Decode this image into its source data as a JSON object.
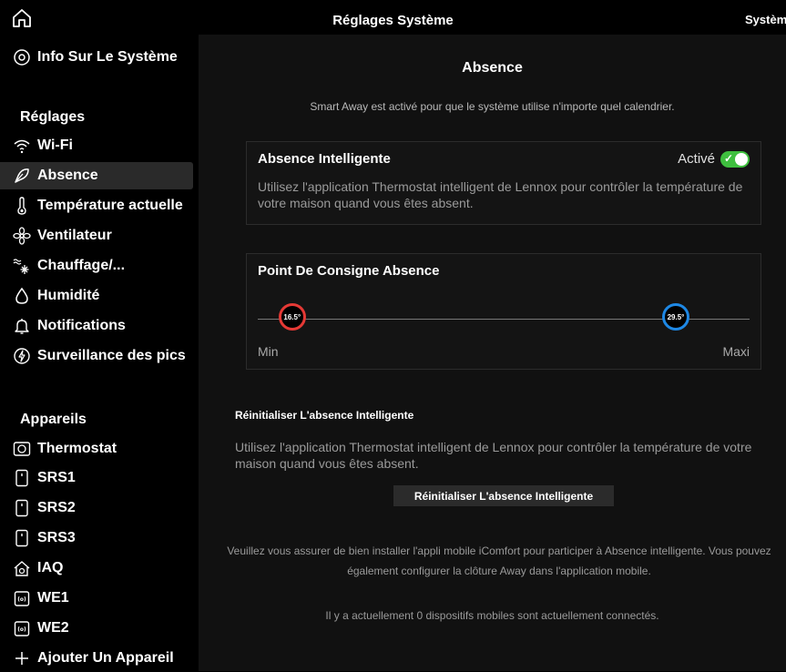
{
  "topbar": {
    "title": "Réglages Système",
    "right_label": "Système"
  },
  "sidebar": {
    "info_label": "Info Sur Le Système",
    "settings_header": "Réglages",
    "settings_items": [
      {
        "label": "Wi-Fi",
        "icon": "wifi-icon"
      },
      {
        "label": "Absence",
        "icon": "away-icon"
      },
      {
        "label": "Température actuelle",
        "icon": "thermometer-icon"
      },
      {
        "label": "Ventilateur",
        "icon": "fan-icon"
      },
      {
        "label": "Chauffage/...",
        "icon": "heat-cool-icon"
      },
      {
        "label": "Humidité",
        "icon": "humidity-icon"
      },
      {
        "label": "Notifications",
        "icon": "bell-icon"
      },
      {
        "label": "Surveillance des pics",
        "icon": "power-icon"
      }
    ],
    "devices_header": "Appareils",
    "devices": [
      {
        "label": "Thermostat",
        "icon": "thermostat-icon"
      },
      {
        "label": "SRS1",
        "icon": "sensor-icon"
      },
      {
        "label": "SRS2",
        "icon": "sensor-icon"
      },
      {
        "label": "SRS3",
        "icon": "sensor-icon"
      },
      {
        "label": "IAQ",
        "icon": "iaq-icon"
      },
      {
        "label": "WE1",
        "icon": "wifi-extender-icon"
      },
      {
        "label": "WE2",
        "icon": "wifi-extender-icon"
      }
    ],
    "add_device_label": "Ajouter Un Appareil",
    "active_item": "Absence"
  },
  "main": {
    "title": "Absence",
    "intro": "Smart Away est activé pour que le système utilise n'importe quel calendrier.",
    "smart_away_card": {
      "title": "Absence Intelligente",
      "status": "Activé",
      "enabled": true,
      "description": "Utilisez l'application Thermostat intelligent de Lennox pour contrôler la température de votre maison quand vous êtes absent."
    },
    "setpoint_card": {
      "title": "Point De Consigne Absence",
      "min_value": "16.5°",
      "max_value": "29.5°",
      "min_label": "Min",
      "max_label": "Maxi",
      "min_fraction": 0.07,
      "max_fraction": 0.85
    },
    "reset": {
      "title": "Réinitialiser L'absence Intelligente",
      "description": "Utilisez l'application Thermostat intelligent de Lennox pour contrôler la température de votre maison quand vous êtes absent.",
      "button_label": "Réinitialiser L'absence Intelligente"
    },
    "note_install": "Veuillez vous assurer de bien installer l'appli mobile iComfort pour participer à Absence intelligente. Vous pouvez également configurer la clôture Away dans l'application mobile.",
    "note_devices": "Il y a actuellement 0 dispositifs mobiles sont actuellement connectés."
  },
  "colors": {
    "toggle_on": "#3fbf3f",
    "min_thumb": "#e53935",
    "max_thumb": "#1e88e5"
  }
}
